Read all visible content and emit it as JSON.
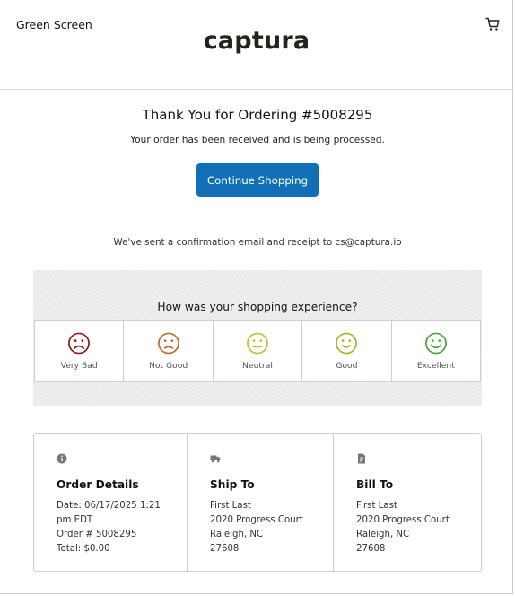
{
  "header": {
    "store_name": "Green Screen",
    "brand": "captura",
    "cart_icon": "cart-icon"
  },
  "confirmation": {
    "title": "Thank You for Ordering #5008295",
    "subtitle": "Your order has been received and is being processed.",
    "continue_label": "Continue Shopping",
    "email_note": "We've sent a confirmation email and receipt to cs@captura.io"
  },
  "survey": {
    "question": "How was your shopping experience?",
    "options": [
      {
        "label": "Very Bad",
        "icon": "very-sad-face-icon",
        "color": "#8b1b12"
      },
      {
        "label": "Not Good",
        "icon": "sad-face-icon",
        "color": "#c46a2c"
      },
      {
        "label": "Neutral",
        "icon": "neutral-face-icon",
        "color": "#d4b62e"
      },
      {
        "label": "Good",
        "icon": "smile-face-icon",
        "color": "#a3b52b"
      },
      {
        "label": "Excellent",
        "icon": "big-smile-face-icon",
        "color": "#49a43a"
      }
    ]
  },
  "details": {
    "order": {
      "icon": "info-icon",
      "title": "Order Details",
      "lines": [
        "Date: 06/17/2025 1:21",
        "pm EDT",
        "Order # 5008295",
        "Total: $0.00"
      ]
    },
    "ship_to": {
      "icon": "truck-icon",
      "title": "Ship To",
      "lines": [
        "First Last",
        "2020 Progress Court",
        "Raleigh, NC",
        "27608"
      ]
    },
    "bill_to": {
      "icon": "invoice-icon",
      "title": "Bill To",
      "lines": [
        "First Last",
        "2020 Progress Court",
        "Raleigh, NC",
        "27608"
      ]
    }
  },
  "colors": {
    "accent": "#1170b5",
    "brand": "#23241c"
  }
}
